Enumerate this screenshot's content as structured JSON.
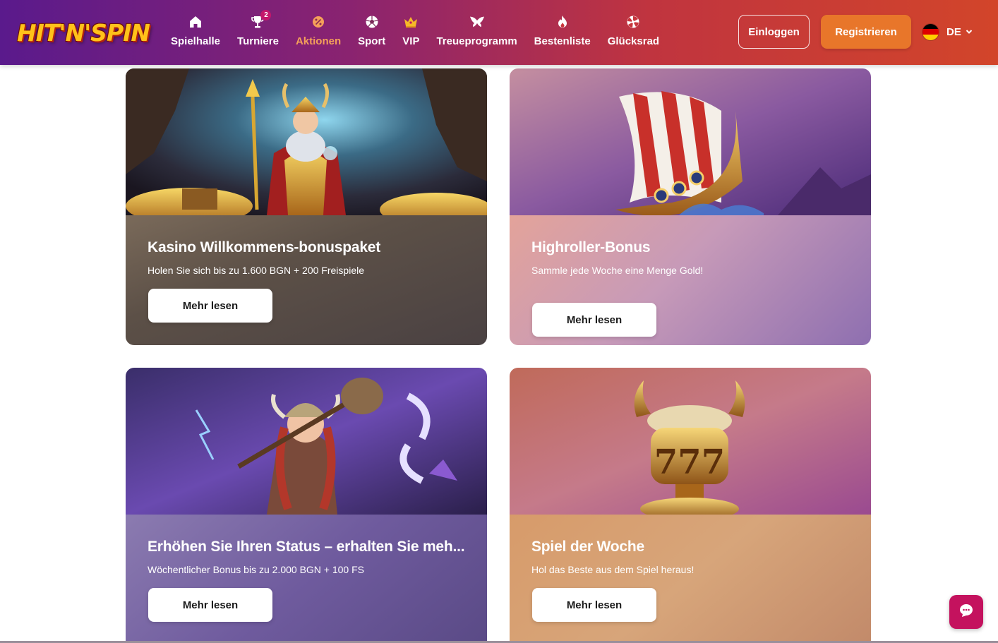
{
  "header": {
    "logo_text": "HIT'N'SPIN",
    "nav": [
      {
        "label": "Spielhalle",
        "icon": "home-icon",
        "active": false
      },
      {
        "label": "Turniere",
        "icon": "trophy-icon",
        "active": false,
        "badge": "2"
      },
      {
        "label": "Aktionen",
        "icon": "promotions-icon",
        "active": true
      },
      {
        "label": "Sport",
        "icon": "soccer-ball-icon",
        "active": false
      },
      {
        "label": "VIP",
        "icon": "crown-icon",
        "active": false
      },
      {
        "label": "Treueprogramm",
        "icon": "wings-icon",
        "active": false
      },
      {
        "label": "Bestenliste",
        "icon": "flame-icon",
        "active": false
      },
      {
        "label": "Glücksrad",
        "icon": "wheel-icon",
        "active": false
      }
    ],
    "login_label": "Einloggen",
    "register_label": "Registrieren",
    "language": "DE"
  },
  "promotions": [
    {
      "title": "Kasino Willkommens-bonuspaket",
      "subtitle": "Holen Sie sich bis zu 1.600 BGN + 200 Freispiele",
      "button": "Mehr lesen"
    },
    {
      "title": "Highroller-Bonus",
      "subtitle": "Sammle jede Woche eine Menge Gold!",
      "button": "Mehr lesen"
    },
    {
      "title": "Erhöhen Sie Ihren Status – erhalten Sie meh...",
      "subtitle": "Wöchentlicher Bonus bis zu 2.000 BGN + 100 FS",
      "button": "Mehr lesen"
    },
    {
      "title": "Spiel der Woche",
      "subtitle": "Hol das Beste aus dem Spiel heraus!",
      "button": "Mehr lesen"
    }
  ],
  "colors": {
    "accent": "#e8762a",
    "active_nav": "#f4a05a",
    "chat": "#c4125e"
  }
}
